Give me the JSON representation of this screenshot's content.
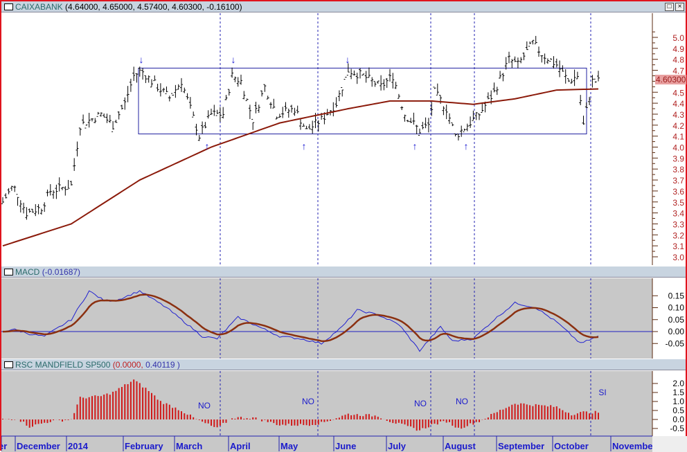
{
  "price_panel": {
    "title": "CAIXABANK",
    "values": "(4.64000, 4.65000, 4.57400, 4.60300, -0.16100)",
    "last_label": "4.60300",
    "maximize_label": "□",
    "close_label": "×"
  },
  "macd_panel": {
    "title": "MACD",
    "values": "(-0.01687)"
  },
  "rsc_panel": {
    "title": "RSC MANDFIELD SP500",
    "values_a": "(0.0000,",
    "values_b": "0.40119 )"
  },
  "annotations": [
    "NO",
    "NO",
    "NO",
    "NO",
    "SI"
  ],
  "colors": {
    "up_down_bars": "#000000",
    "sma": "#8b1a0a",
    "macd": "#2020d0",
    "signal": "#8b3010",
    "hist": "#d01818",
    "axis_text": "#b02020",
    "month_text": "#1a1acc"
  },
  "chart_data": [
    {
      "type": "line",
      "title": "CAIXABANK",
      "ylim": [
        3.0,
        5.0
      ],
      "yticks": [
        "3.0",
        "3.1",
        "3.2",
        "3.3",
        "3.4",
        "3.5",
        "3.6",
        "3.7",
        "3.8",
        "3.9",
        "4.0",
        "4.1",
        "4.2",
        "4.3",
        "4.4",
        "4.5",
        "4.7",
        "4.8",
        "4.9",
        "5.0"
      ],
      "xlabel_months": [
        "er",
        "December",
        "2014",
        "February",
        "March",
        "April",
        "May",
        "June",
        "July",
        "August",
        "September",
        "October",
        "November"
      ],
      "price_keypoints": [
        [
          0,
          3.5
        ],
        [
          3.5,
          3.65
        ],
        [
          8,
          3.4
        ],
        [
          13,
          3.45
        ],
        [
          16,
          3.6
        ],
        [
          23,
          3.65
        ],
        [
          26,
          4.2
        ],
        [
          33,
          4.3
        ],
        [
          37,
          4.2
        ],
        [
          41,
          4.4
        ],
        [
          44,
          4.65
        ],
        [
          46.5,
          4.7
        ],
        [
          50,
          4.6
        ],
        [
          56,
          4.45
        ],
        [
          60,
          4.6
        ],
        [
          66,
          4.1
        ],
        [
          70,
          4.3
        ],
        [
          74,
          4.3
        ],
        [
          77,
          4.65
        ],
        [
          80,
          4.6
        ],
        [
          84,
          4.25
        ],
        [
          88,
          4.55
        ],
        [
          92,
          4.3
        ],
        [
          98,
          4.35
        ],
        [
          102,
          4.15
        ],
        [
          107,
          4.25
        ],
        [
          112,
          4.4
        ],
        [
          116,
          4.7
        ],
        [
          121,
          4.65
        ],
        [
          127,
          4.55
        ],
        [
          131,
          4.65
        ],
        [
          135,
          4.3
        ],
        [
          140,
          4.15
        ],
        [
          143,
          4.2
        ],
        [
          145,
          4.5
        ],
        [
          149,
          4.35
        ],
        [
          152,
          4.1
        ],
        [
          156,
          4.2
        ],
        [
          160,
          4.3
        ],
        [
          165,
          4.5
        ],
        [
          170,
          4.8
        ],
        [
          173,
          4.75
        ],
        [
          178,
          4.95
        ],
        [
          181,
          4.85
        ],
        [
          186,
          4.75
        ],
        [
          190,
          4.6
        ],
        [
          193,
          4.65
        ],
        [
          195,
          4.2
        ],
        [
          198,
          4.6
        ],
        [
          200,
          4.6
        ]
      ],
      "sma_keypoints": [
        [
          0,
          3.1
        ],
        [
          23,
          3.3
        ],
        [
          46,
          3.7
        ],
        [
          70,
          4.0
        ],
        [
          93,
          4.22
        ],
        [
          116,
          4.35
        ],
        [
          130,
          4.42
        ],
        [
          144,
          4.42
        ],
        [
          158,
          4.39
        ],
        [
          172,
          4.44
        ],
        [
          186,
          4.52
        ],
        [
          200,
          4.53
        ]
      ],
      "range_box": [
        4.12,
        4.72
      ],
      "last": 4.603
    },
    {
      "type": "line",
      "title": "MACD",
      "ylim": [
        -0.09,
        0.22
      ],
      "yticks": [
        "0.15",
        "0.10",
        "0.05",
        "0.00",
        "-0.05"
      ],
      "macd_keypoints": [
        [
          0,
          0.0
        ],
        [
          3.5,
          0.01
        ],
        [
          9,
          -0.01
        ],
        [
          14,
          -0.02
        ],
        [
          23,
          0.05
        ],
        [
          29,
          0.17
        ],
        [
          34,
          0.13
        ],
        [
          38,
          0.13
        ],
        [
          46,
          0.17
        ],
        [
          55,
          0.1
        ],
        [
          60,
          0.05
        ],
        [
          67,
          -0.02
        ],
        [
          72,
          -0.03
        ],
        [
          79,
          0.06
        ],
        [
          86,
          0.02
        ],
        [
          93,
          -0.02
        ],
        [
          100,
          -0.03
        ],
        [
          107,
          -0.05
        ],
        [
          114,
          0.02
        ],
        [
          119,
          0.09
        ],
        [
          126,
          0.07
        ],
        [
          133,
          0.03
        ],
        [
          140,
          -0.08
        ],
        [
          147,
          0.02
        ],
        [
          151,
          -0.04
        ],
        [
          158,
          -0.03
        ],
        [
          165,
          0.05
        ],
        [
          172,
          0.12
        ],
        [
          179,
          0.1
        ],
        [
          186,
          0.04
        ],
        [
          194,
          -0.05
        ],
        [
          200,
          -0.02
        ]
      ]
    },
    {
      "type": "bar",
      "title": "RSC MANDFIELD SP500",
      "ylim": [
        -0.95,
        2.6
      ],
      "yticks": [
        "2.0",
        "1.5",
        "1.0",
        "0.5",
        "0.0",
        "-0.5"
      ],
      "keypoints": [
        [
          0,
          0.0
        ],
        [
          5,
          0.05
        ],
        [
          9,
          -0.4
        ],
        [
          16,
          -0.1
        ],
        [
          23,
          0.0
        ],
        [
          26,
          1.2
        ],
        [
          33,
          1.3
        ],
        [
          37,
          1.5
        ],
        [
          44,
          2.2
        ],
        [
          49,
          1.6
        ],
        [
          53,
          1.0
        ],
        [
          60,
          0.5
        ],
        [
          65,
          0.0
        ],
        [
          72,
          -0.5
        ],
        [
          77,
          0.1
        ],
        [
          84,
          0.1
        ],
        [
          93,
          -0.3
        ],
        [
          102,
          -0.3
        ],
        [
          107,
          -0.2
        ],
        [
          116,
          0.3
        ],
        [
          126,
          0.2
        ],
        [
          130,
          -0.1
        ],
        [
          140,
          -0.6
        ],
        [
          144,
          -0.3
        ],
        [
          149,
          -0.1
        ],
        [
          153,
          -0.5
        ],
        [
          160,
          -0.1
        ],
        [
          167,
          0.5
        ],
        [
          172,
          0.9
        ],
        [
          179,
          0.8
        ],
        [
          186,
          0.7
        ],
        [
          191,
          0.3
        ],
        [
          195,
          0.4
        ],
        [
          200,
          0.4
        ]
      ]
    }
  ]
}
